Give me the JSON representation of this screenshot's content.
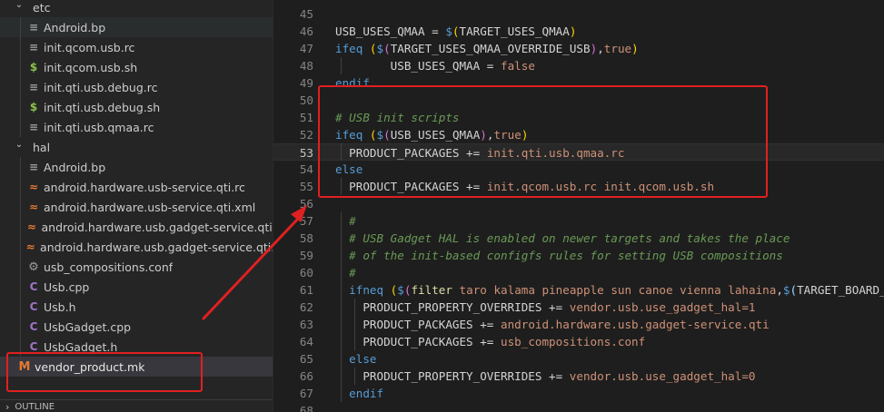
{
  "sidebar": {
    "rows": [
      {
        "type": "folder",
        "name": "etc",
        "indent": 1
      },
      {
        "type": "lines",
        "name": "Android.bp",
        "indent": 2,
        "state": "active"
      },
      {
        "type": "lines",
        "name": "init.qcom.usb.rc",
        "indent": 2
      },
      {
        "type": "dollar",
        "name": "init.qcom.usb.sh",
        "indent": 2
      },
      {
        "type": "lines",
        "name": "init.qti.usb.debug.rc",
        "indent": 2
      },
      {
        "type": "dollar",
        "name": "init.qti.usb.debug.sh",
        "indent": 2
      },
      {
        "type": "lines",
        "name": "init.qti.usb.qmaa.rc",
        "indent": 2
      },
      {
        "type": "folder",
        "name": "hal",
        "indent": 1
      },
      {
        "type": "lines",
        "name": "Android.bp",
        "indent": 2
      },
      {
        "type": "rss",
        "name": "android.hardware.usb-service.qti.rc",
        "indent": 2
      },
      {
        "type": "rss",
        "name": "android.hardware.usb-service.qti.xml",
        "indent": 2
      },
      {
        "type": "rss",
        "name": "android.hardware.usb.gadget-service.qti.rc",
        "indent": 2
      },
      {
        "type": "rss",
        "name": "android.hardware.usb.gadget-service.qti.xml",
        "indent": 2
      },
      {
        "type": "gear",
        "name": "usb_compositions.conf",
        "indent": 2
      },
      {
        "type": "cee",
        "name": "Usb.cpp",
        "indent": 2
      },
      {
        "type": "cee",
        "name": "Usb.h",
        "indent": 2
      },
      {
        "type": "cee",
        "name": "UsbGadget.cpp",
        "indent": 2
      },
      {
        "type": "cee",
        "name": "UsbGadget.h",
        "indent": 2
      },
      {
        "type": "em",
        "name": "vendor_product.mk",
        "indent": 1,
        "state": "selected"
      }
    ],
    "outline_label": "OUTLINE"
  },
  "editor": {
    "current_line": 53,
    "lines": [
      {
        "n": "45",
        "tokens": []
      },
      {
        "n": "46",
        "tokens": [
          [
            "d",
            "USB_USES_QMAA = "
          ],
          [
            "k",
            "$"
          ],
          [
            "p",
            "("
          ],
          [
            "d",
            "TARGET_USES_QMAA"
          ],
          [
            "p",
            ")"
          ]
        ]
      },
      {
        "n": "47",
        "tokens": [
          [
            "k",
            "ifeq "
          ],
          [
            "p",
            "("
          ],
          [
            "k",
            "$"
          ],
          [
            "p2",
            "("
          ],
          [
            "d",
            "TARGET_USES_QMAA_OVERRIDE_USB"
          ],
          [
            "p2",
            ")"
          ],
          [
            "d",
            ","
          ],
          [
            "s",
            "true"
          ],
          [
            "p",
            ")"
          ]
        ]
      },
      {
        "n": "48",
        "tokens": [
          [
            "d",
            "        USB_USES_QMAA = "
          ],
          [
            "s",
            "false"
          ]
        ]
      },
      {
        "n": "49",
        "tokens": [
          [
            "k",
            "endif"
          ]
        ]
      },
      {
        "n": "50",
        "tokens": []
      },
      {
        "n": "51",
        "tokens": [
          [
            "c",
            "# USB init scripts"
          ]
        ]
      },
      {
        "n": "52",
        "tokens": [
          [
            "k",
            "ifeq "
          ],
          [
            "p",
            "("
          ],
          [
            "k",
            "$"
          ],
          [
            "p2",
            "("
          ],
          [
            "d",
            "USB_USES_QMAA"
          ],
          [
            "p2",
            ")"
          ],
          [
            "d",
            ","
          ],
          [
            "s",
            "true"
          ],
          [
            "p",
            ")"
          ]
        ]
      },
      {
        "n": "53",
        "tokens": [
          [
            "d",
            "  PRODUCT_PACKAGES += "
          ],
          [
            "s",
            "init.qti.usb.qmaa.rc"
          ]
        ]
      },
      {
        "n": "54",
        "tokens": [
          [
            "k",
            "else"
          ]
        ]
      },
      {
        "n": "55",
        "tokens": [
          [
            "d",
            "  PRODUCT_PACKAGES += "
          ],
          [
            "s",
            "init.qcom.usb.rc init.qcom.usb.sh"
          ]
        ]
      },
      {
        "n": "56",
        "tokens": []
      },
      {
        "n": "57",
        "tokens": [
          [
            "c",
            "  #"
          ]
        ]
      },
      {
        "n": "58",
        "tokens": [
          [
            "c",
            "  # USB Gadget HAL is enabled on newer targets and takes the place"
          ]
        ]
      },
      {
        "n": "59",
        "tokens": [
          [
            "c",
            "  # of the init-based configfs rules for setting USB compositions"
          ]
        ]
      },
      {
        "n": "60",
        "tokens": [
          [
            "c",
            "  #"
          ]
        ]
      },
      {
        "n": "61",
        "tokens": [
          [
            "d",
            "  "
          ],
          [
            "k",
            "ifneq "
          ],
          [
            "p",
            "("
          ],
          [
            "k",
            "$"
          ],
          [
            "p2",
            "("
          ],
          [
            "f",
            "filter"
          ],
          [
            "s",
            " taro kalama pineapple sun canoe vienna lahaina"
          ],
          [
            "d",
            ","
          ],
          [
            "k",
            "$"
          ],
          [
            "v",
            "("
          ],
          [
            "d",
            "TARGET_BOARD_PLATFORM"
          ],
          [
            "v",
            ")"
          ],
          [
            "p2",
            ")"
          ],
          [
            "d",
            ","
          ],
          [
            "p",
            ")"
          ]
        ]
      },
      {
        "n": "62",
        "tokens": [
          [
            "d",
            "    PRODUCT_PROPERTY_OVERRIDES += "
          ],
          [
            "s",
            "vendor.usb.use_gadget_hal=1"
          ]
        ]
      },
      {
        "n": "63",
        "tokens": [
          [
            "d",
            "    PRODUCT_PACKAGES += "
          ],
          [
            "s",
            "android.hardware.usb.gadget-service.qti"
          ]
        ]
      },
      {
        "n": "64",
        "tokens": [
          [
            "d",
            "    PRODUCT_PACKAGES += "
          ],
          [
            "s",
            "usb_compositions.conf"
          ]
        ]
      },
      {
        "n": "65",
        "tokens": [
          [
            "d",
            "  "
          ],
          [
            "k",
            "else"
          ]
        ]
      },
      {
        "n": "66",
        "tokens": [
          [
            "d",
            "    PRODUCT_PROPERTY_OVERRIDES += "
          ],
          [
            "s",
            "vendor.usb.use_gadget_hal=0"
          ]
        ]
      },
      {
        "n": "67",
        "tokens": [
          [
            "d",
            "  "
          ],
          [
            "k",
            "endif"
          ]
        ]
      },
      {
        "n": "68",
        "tokens": []
      }
    ]
  },
  "annotations": {
    "color": "#e02020"
  }
}
